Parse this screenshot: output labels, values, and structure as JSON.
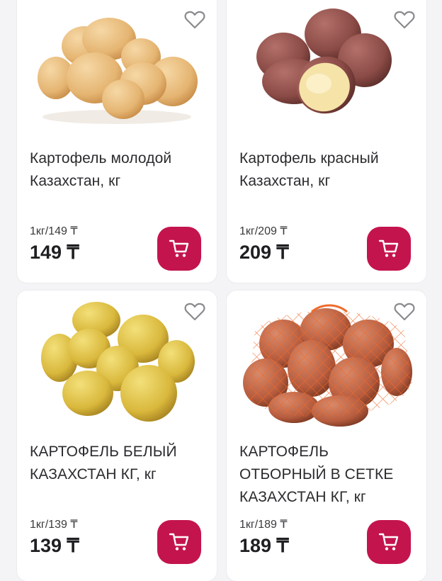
{
  "products": [
    {
      "title": "Картофель молодой Казахстан, кг",
      "unit_price": "1кг/149 ₸",
      "price": "149 ₸",
      "image_icon": "young-potatoes-image",
      "fav_icon": "heart-outline-icon",
      "cart_icon": "shopping-cart-icon"
    },
    {
      "title": "Картофель красный Казахстан, кг",
      "unit_price": "1кг/209 ₸",
      "price": "209 ₸",
      "image_icon": "red-potatoes-image",
      "fav_icon": "heart-outline-icon",
      "cart_icon": "shopping-cart-icon"
    },
    {
      "title": "КАРТОФЕЛЬ БЕЛЫЙ КАЗАХСТАН КГ, кг",
      "unit_price": "1кг/139 ₸",
      "price": "139 ₸",
      "image_icon": "white-potatoes-image",
      "fav_icon": "heart-outline-icon",
      "cart_icon": "shopping-cart-icon"
    },
    {
      "title": "КАРТОФЕЛЬ ОТБОРНЫЙ В СЕТКЕ КАЗАХСТАН КГ, кг",
      "unit_price": "1кг/189 ₸",
      "price": "189 ₸",
      "image_icon": "netted-potatoes-image",
      "fav_icon": "heart-outline-icon",
      "cart_icon": "shopping-cart-icon"
    }
  ],
  "colors": {
    "accent": "#c4144d",
    "background": "#f4f4f6",
    "card": "#ffffff",
    "text": "#2b2b2e"
  }
}
